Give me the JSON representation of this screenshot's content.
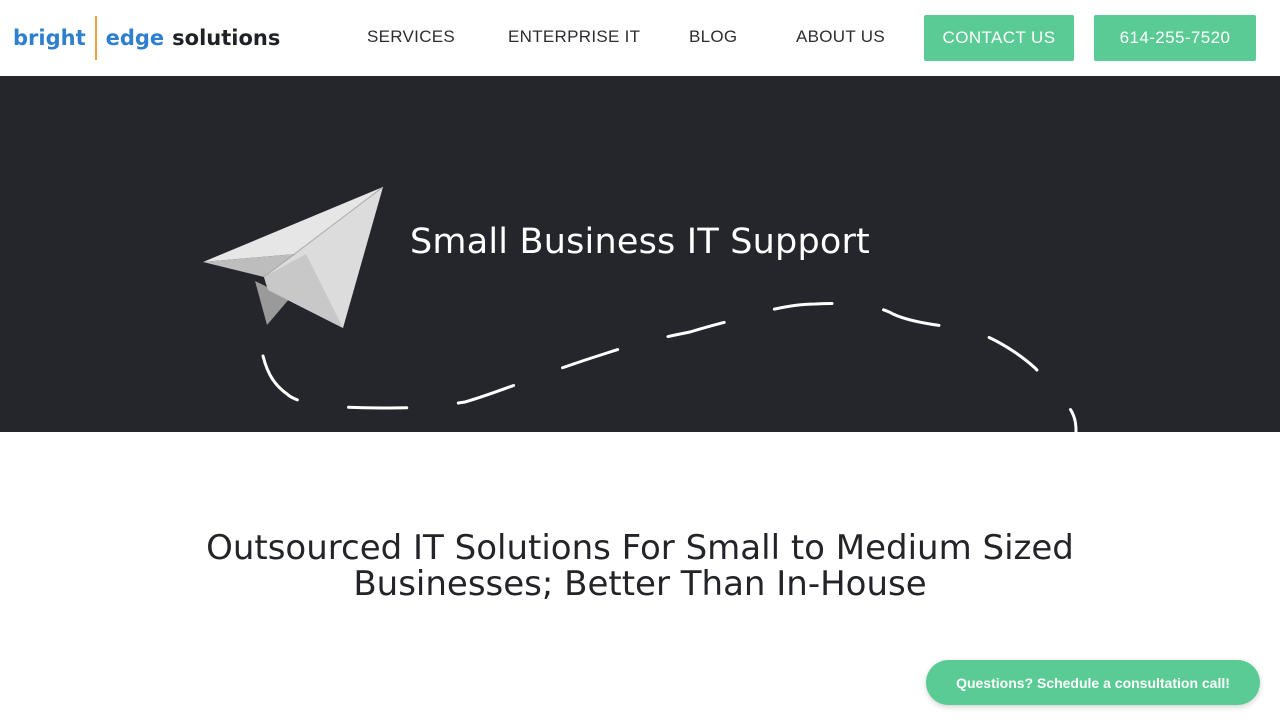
{
  "header": {
    "logo": {
      "word1": "bright",
      "word2": "edge",
      "word3": "solutions"
    },
    "nav": {
      "services": "SERVICES",
      "enterprise": "ENTERPRISE IT",
      "blog": "BLOG",
      "about": "ABOUT US"
    },
    "contact_button": "CONTACT US",
    "phone_button": "614-255-7520"
  },
  "hero": {
    "title": "Small Business IT Support",
    "icon": "paper-plane-icon"
  },
  "main": {
    "heading_line1": "Outsourced IT Solutions For Small to Medium Sized",
    "heading_line2": "Businesses; Better Than In-House"
  },
  "chat": {
    "label": "Questions? Schedule a consultation call!"
  },
  "colors": {
    "accent_green": "#5acb94",
    "logo_blue": "#2f7fcf",
    "logo_divider": "#f0a23a",
    "hero_bg": "#25262b"
  }
}
